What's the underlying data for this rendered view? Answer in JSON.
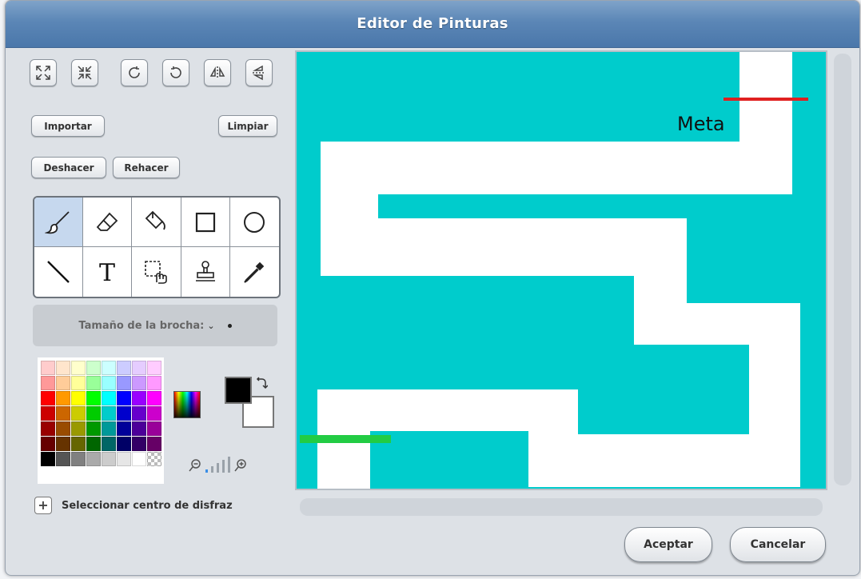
{
  "window": {
    "title": "Editor de Pinturas"
  },
  "transform_icons": [
    "grow-icon",
    "shrink-icon",
    "rotate-left-icon",
    "rotate-right-icon",
    "flip-horizontal-icon",
    "flip-vertical-icon"
  ],
  "buttons": {
    "import_label": "Importar",
    "clear_label": "Limpiar",
    "undo_label": "Deshacer",
    "redo_label": "Rehacer"
  },
  "tools": [
    {
      "name": "paintbrush",
      "selected": true
    },
    {
      "name": "eraser",
      "selected": false
    },
    {
      "name": "fill-bucket",
      "selected": false
    },
    {
      "name": "rectangle",
      "selected": false
    },
    {
      "name": "ellipse",
      "selected": false
    },
    {
      "name": "line",
      "selected": false
    },
    {
      "name": "text",
      "selected": false
    },
    {
      "name": "select",
      "selected": false
    },
    {
      "name": "stamp",
      "selected": false
    },
    {
      "name": "eyedropper",
      "selected": false
    }
  ],
  "brush": {
    "label": "Tamaño de la brocha:"
  },
  "colors": {
    "foreground": "#000000",
    "background": "#ffffff",
    "palette": [
      "#ffcccc",
      "#ffe5cc",
      "#ffffcc",
      "#ccffcc",
      "#ccffff",
      "#ccccff",
      "#e5ccff",
      "#ffccff",
      "#ff9999",
      "#ffcc99",
      "#ffff99",
      "#99ff99",
      "#99ffff",
      "#9999ff",
      "#cc99ff",
      "#ff99ff",
      "#ff0000",
      "#ff9900",
      "#ffff00",
      "#00ff00",
      "#00ffff",
      "#0000ff",
      "#9900ff",
      "#ff00ff",
      "#cc0000",
      "#cc6600",
      "#cccc00",
      "#00cc00",
      "#00cccc",
      "#0000cc",
      "#6600cc",
      "#cc00cc",
      "#990000",
      "#994c00",
      "#999900",
      "#009900",
      "#009999",
      "#000099",
      "#4c0099",
      "#990099",
      "#660000",
      "#663300",
      "#666600",
      "#006600",
      "#006666",
      "#000066",
      "#330066",
      "#660066",
      "#000000",
      "#555555",
      "#808080",
      "#aaaaaa",
      "#cccccc",
      "#e6e6e6",
      "#ffffff",
      "transparent"
    ]
  },
  "canvas": {
    "meta_label": "Meta",
    "background_color": "#00cccc",
    "path_color": "#ffffff",
    "finish_line_color": "#e02020",
    "start_line_color": "#22cc44"
  },
  "footer": {
    "center_label": "Seleccionar centro de disfraz",
    "accept_label": "Aceptar",
    "cancel_label": "Cancelar"
  }
}
